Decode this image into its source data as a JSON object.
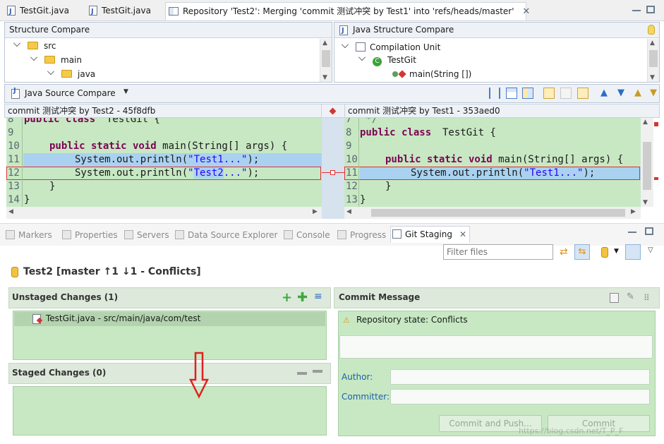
{
  "editor_tabs": [
    {
      "label": "TestGit.java"
    },
    {
      "label": "TestGit.java"
    },
    {
      "label": "Repository 'Test2': Merging 'commit 测试冲突 by Test1' into 'refs/heads/master'"
    }
  ],
  "structure_compare": {
    "title": "Structure Compare",
    "tree": [
      "src",
      "main",
      "java"
    ]
  },
  "java_structure_compare": {
    "title": "Java Structure Compare",
    "tree": [
      "Compilation Unit",
      "TestGit",
      "main(String [])"
    ]
  },
  "source_compare": {
    "title": "Java Source Compare",
    "left_header": "commit 测试冲突 by Test2 - 45f8dfb",
    "right_header": "commit 测试冲突 by Test1 - 353aed0",
    "left_lines": [
      {
        "n": "8",
        "t": "public class TestGit {"
      },
      {
        "n": "9",
        "t": ""
      },
      {
        "n": "10",
        "t": "    public static void main(String[] args) {"
      },
      {
        "n": "11",
        "t": "        System.out.println(\"Test1...\");"
      },
      {
        "n": "12",
        "t": "        System.out.println(\"Test2...\");"
      },
      {
        "n": "13",
        "t": "    }"
      },
      {
        "n": "14",
        "t": "}"
      }
    ],
    "right_lines": [
      {
        "n": "7",
        "t": " */"
      },
      {
        "n": "8",
        "t": "public class TestGit {"
      },
      {
        "n": "9",
        "t": ""
      },
      {
        "n": "10",
        "t": "    public static void main(String[] args) {"
      },
      {
        "n": "11",
        "t": "        System.out.println(\"Test1...\");"
      },
      {
        "n": "12",
        "t": "    }"
      },
      {
        "n": "13",
        "t": "}"
      }
    ]
  },
  "views": {
    "tabs": [
      "Markers",
      "Properties",
      "Servers",
      "Data Source Explorer",
      "Console",
      "Progress",
      "Git Staging"
    ],
    "filter_placeholder": "Filter files"
  },
  "staging": {
    "repo_title": "Test2 [master ↑1 ↓1 - Conflicts]",
    "unstaged_title": "Unstaged Changes (1)",
    "unstaged_items": [
      "TestGit.java - src/main/java/com/test"
    ],
    "staged_title": "Staged Changes (0)",
    "commit_title": "Commit Message",
    "repo_state": "Repository state: Conflicts",
    "author_label": "Author:",
    "committer_label": "Committer:",
    "commit_push_label": "Commit and Push...",
    "commit_label": "Commit",
    "watermark": "https://blog.csdn.net/T_P_F"
  },
  "colors": {
    "compare_bg": "#c7e8c3",
    "highlight": "#aad2f0",
    "conflict": "#e03030",
    "keyword": "#7f0055",
    "string": "#2a00ff"
  }
}
